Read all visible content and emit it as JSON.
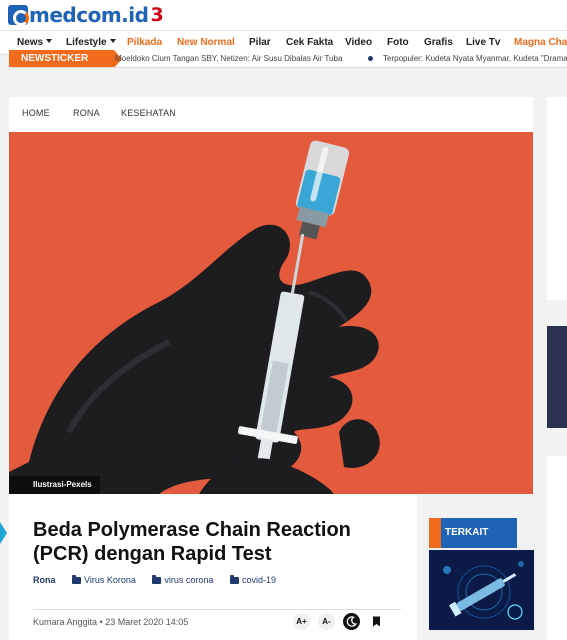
{
  "site": {
    "logo_text": "medcom.id",
    "logo_badge": "3"
  },
  "nav": {
    "items": [
      {
        "label": "News",
        "dropdown": true,
        "orange": false
      },
      {
        "label": "Lifestyle",
        "dropdown": true,
        "orange": false
      },
      {
        "label": "Pilkada",
        "dropdown": false,
        "orange": true
      },
      {
        "label": "New Normal",
        "dropdown": false,
        "orange": true
      },
      {
        "label": "Pilar",
        "dropdown": false,
        "orange": false
      },
      {
        "label": "Cek Fakta",
        "dropdown": false,
        "orange": false
      },
      {
        "label": "Video",
        "dropdown": false,
        "orange": false
      },
      {
        "label": "Foto",
        "dropdown": false,
        "orange": false
      },
      {
        "label": "Grafis",
        "dropdown": false,
        "orange": false
      },
      {
        "label": "Live Tv",
        "dropdown": false,
        "orange": false
      },
      {
        "label": "Magna Cha",
        "dropdown": false,
        "orange": true
      }
    ]
  },
  "ticker": {
    "label": "NEWSTICKER",
    "items": [
      "Moeldoko Cium Tangan SBY, Netizen: Air Susu Dibalas Air Tuba",
      "Terpopuler: Kudeta Nyata Myanmar, Kudeta \"Drama"
    ]
  },
  "breadcrumb": [
    "HOME",
    "RONA",
    "KESEHATAN"
  ],
  "hero": {
    "caption": "Ilustrasi-Pexels"
  },
  "article": {
    "title": "Beda Polymerase Chain Reaction (PCR) dengan Rapid Test",
    "category": "Rona",
    "tags": [
      "Virus Korona",
      "virus corona",
      "covid-19"
    ],
    "author": "Kumara Anggita",
    "date": "23 Maret 2020 14:05",
    "meta_separator": " • ",
    "tools": {
      "font_up": "A+",
      "font_down": "A-",
      "dark_mode_icon": "moon-icon",
      "bookmark_icon": "bookmark-icon"
    }
  },
  "related": {
    "label": "TERKAIT"
  },
  "colors": {
    "brand_blue": "#1e63b5",
    "accent_orange": "#f26b1d",
    "hero_bg": "#e45a3d",
    "tag_blue": "#1e3a6e"
  }
}
